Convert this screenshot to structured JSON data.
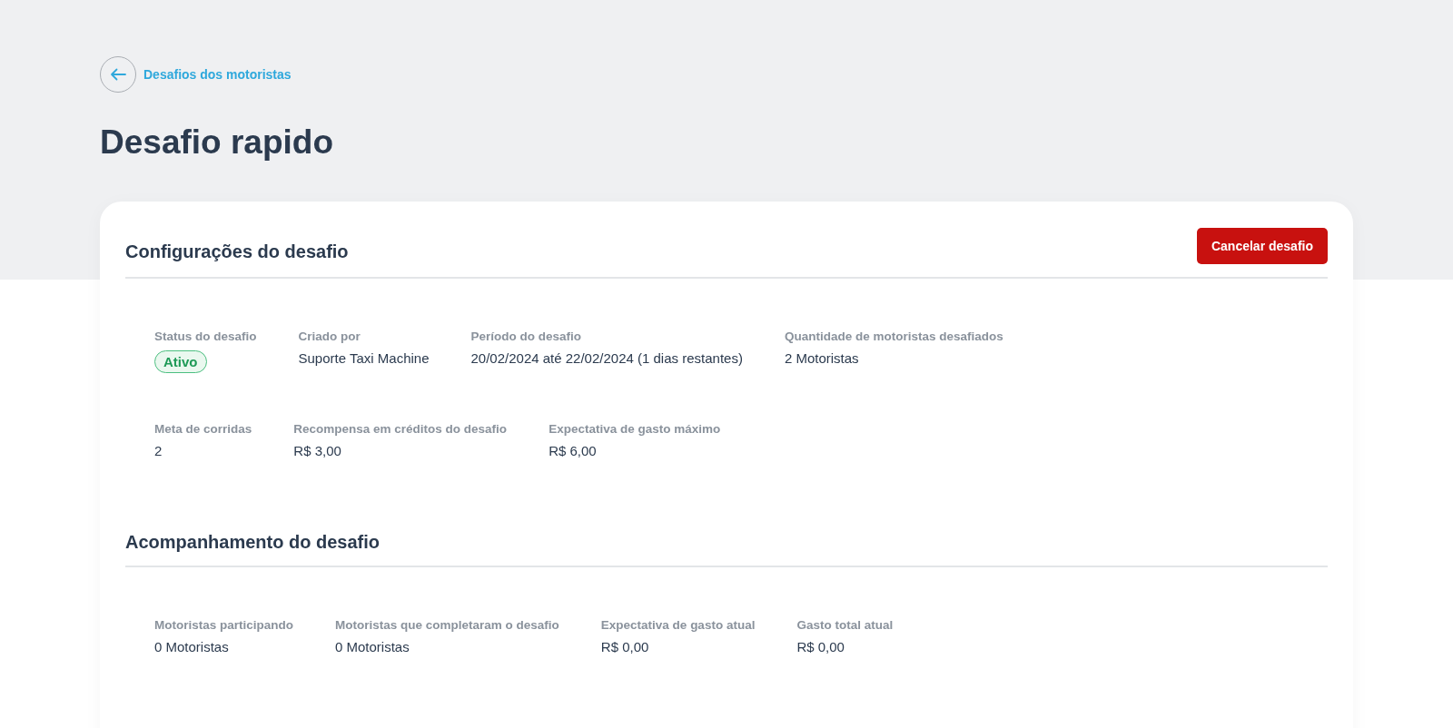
{
  "breadcrumb": {
    "label": "Desafios dos motoristas"
  },
  "title": "Desafio rapido",
  "sections": [
    {
      "heading": "Configurações do desafio",
      "action": "Cancelar desafio",
      "rows": [
        [
          {
            "label": "Status do desafio",
            "value": "Ativo",
            "kind": "badge"
          },
          {
            "label": "Criado por",
            "value": "Suporte Taxi Machine",
            "kind": "text"
          },
          {
            "label": "Período do desafio",
            "value": "20/02/2024 até 22/02/2024 (1 dias restantes)",
            "kind": "text"
          },
          {
            "label": "Quantidade de motoristas desafiados",
            "value": "2 Motoristas",
            "kind": "text"
          }
        ],
        [
          {
            "label": "Meta de corridas",
            "value": "2",
            "kind": "text"
          },
          {
            "label": "Recompensa em créditos do desafio",
            "value": "R$ 3,00",
            "kind": "text"
          },
          {
            "label": "Expectativa de gasto máximo",
            "value": "R$ 6,00",
            "kind": "text"
          }
        ]
      ]
    },
    {
      "heading": "Acompanhamento do desafio",
      "rows": [
        [
          {
            "label": "Motoristas participando",
            "value": "0 Motoristas",
            "kind": "text"
          },
          {
            "label": "Motoristas que completaram o desafio",
            "value": "0 Motoristas",
            "kind": "text"
          },
          {
            "label": "Expectativa de gasto atual",
            "value": "R$ 0,00",
            "kind": "text"
          },
          {
            "label": "Gasto total atual",
            "value": "R$ 0,00",
            "kind": "text"
          }
        ]
      ]
    }
  ]
}
